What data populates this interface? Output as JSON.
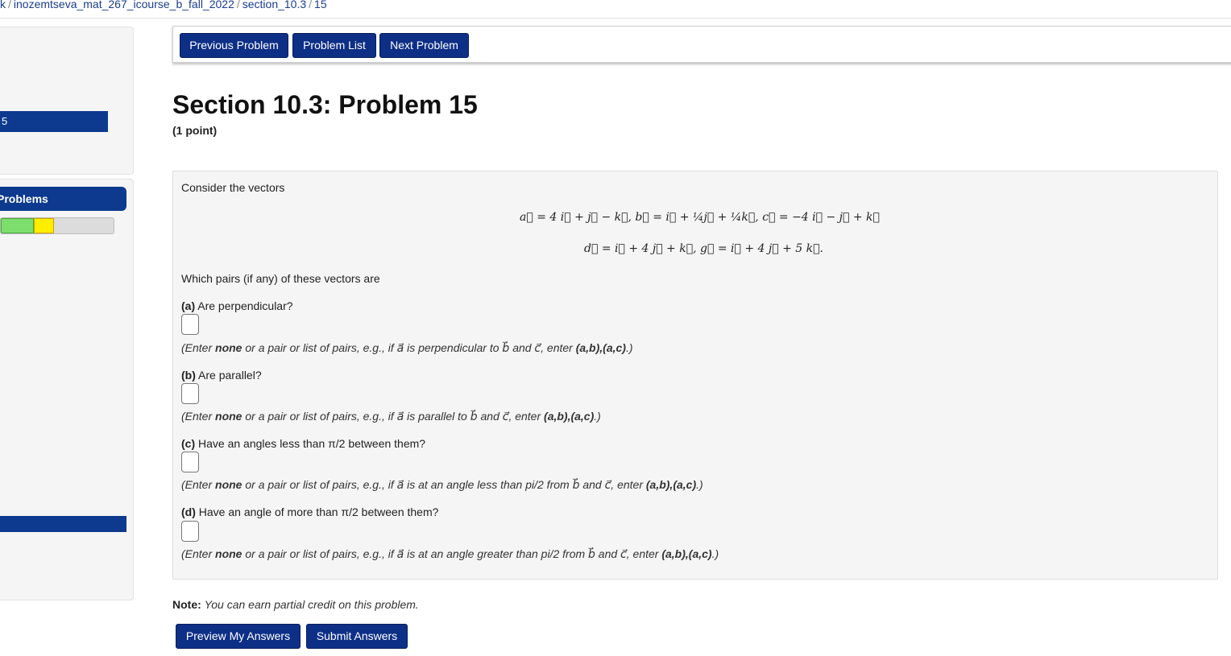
{
  "breadcrumb": {
    "items": [
      "k",
      "inozemtseva_mat_267_icourse_b_fall_2022",
      "section_10.3",
      "15"
    ],
    "separator": "/"
  },
  "sidebar": {
    "active_item": "5",
    "problems_header": "Problems",
    "progress": {
      "correct_fraction": 0.29,
      "partial_fraction": 0.18
    }
  },
  "nav": {
    "previous": "Previous Problem",
    "list": "Problem List",
    "next": "Next Problem"
  },
  "problem": {
    "title": "Section 10.3: Problem 15",
    "points": "(1 point)",
    "intro": "Consider the vectors",
    "vectors_line1": "a⃗ = 4 i⃗ + j⃗ − k⃗,      b⃗ = i⃗ + ¼j⃗ + ¼k⃗,      c⃗ = −4 i⃗ − j⃗ + k⃗",
    "vectors_line2": "d⃗ = i⃗ + 4 j⃗ + k⃗,      g⃗ = i⃗ + 4 j⃗ + 5 k⃗.",
    "question": "Which pairs (if any) of these vectors are",
    "parts": [
      {
        "label": "(a)",
        "prompt": "Are perpendicular?",
        "hint_pre": "(Enter ",
        "hint_none": "none",
        "hint_mid": " or a pair or list of pairs, e.g., if a⃗ is perpendicular to b⃗ and c⃗, enter ",
        "hint_example": "(a,b),(a,c)",
        "hint_post": ".)"
      },
      {
        "label": "(b)",
        "prompt": "Are parallel?",
        "hint_pre": "(Enter ",
        "hint_none": "none",
        "hint_mid": " or a pair or list of pairs, e.g., if a⃗ is parallel to b⃗ and c⃗, enter ",
        "hint_example": "(a,b),(a,c)",
        "hint_post": ".)"
      },
      {
        "label": "(c)",
        "prompt": "Have an angles less than π/2 between them?",
        "hint_pre": "(Enter ",
        "hint_none": "none",
        "hint_mid": " or a pair or list of pairs, e.g., if a⃗ is at an angle less than pi/2 from b⃗ and c⃗, enter ",
        "hint_example": "(a,b),(a,c)",
        "hint_post": ".)"
      },
      {
        "label": "(d)",
        "prompt": "Have an angle of more than π/2 between them?",
        "hint_pre": "(Enter ",
        "hint_none": "none",
        "hint_mid": " or a pair or list of pairs, e.g., if a⃗ is at an angle greater than pi/2 from b⃗ and c⃗, enter ",
        "hint_example": "(a,b),(a,c)",
        "hint_post": ".)"
      }
    ]
  },
  "note": {
    "label": "Note:",
    "text": "You can earn partial credit on this problem."
  },
  "actions": {
    "preview": "Preview My Answers",
    "submit": "Submit Answers"
  },
  "colors": {
    "button_bg": "#0d2f86",
    "sidebar_active": "#0d3a8e",
    "problem_bg": "#f5f5f5",
    "progress_green": "#7dde6d",
    "progress_yellow": "#ffee00"
  }
}
